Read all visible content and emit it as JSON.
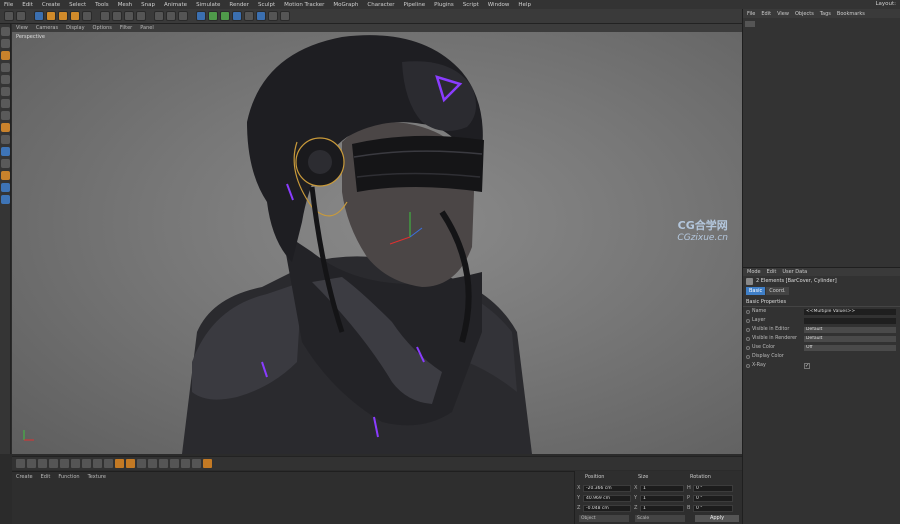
{
  "menubar": {
    "items": [
      "File",
      "Edit",
      "Create",
      "Select",
      "Tools",
      "Mesh",
      "Snap",
      "Animate",
      "Simulate",
      "Render",
      "Sculpt",
      "Motion Tracker",
      "MoGraph",
      "Character",
      "Pipeline",
      "Plugins",
      "Script",
      "Window",
      "Help"
    ],
    "layout_label": "Layout:"
  },
  "viewport": {
    "menu": [
      "View",
      "Cameras",
      "Display",
      "Options",
      "Filter",
      "Panel"
    ],
    "camera_label": "Perspective"
  },
  "watermark": {
    "line1": "CG合学网",
    "line2": "CGzixue.cn"
  },
  "bottom_manager": {
    "menu": [
      "Create",
      "Edit",
      "Function",
      "Texture"
    ]
  },
  "coordinates": {
    "headers": {
      "position": "Position",
      "size": "Size",
      "rotation": "Rotation"
    },
    "rows": [
      {
        "axis": "X",
        "position": "-20.366 cm",
        "size_axis": "X",
        "size": "1",
        "rot_axis": "H",
        "rotation": "0 °"
      },
      {
        "axis": "Y",
        "position": "40.969 cm",
        "size_axis": "Y",
        "size": "1",
        "rot_axis": "P",
        "rotation": "0 °"
      },
      {
        "axis": "Z",
        "position": "-0.048 cm",
        "size_axis": "Z",
        "size": "1",
        "rot_axis": "B",
        "rotation": "0 °"
      }
    ],
    "mode1": "Object",
    "mode2": "Scale",
    "apply": "Apply"
  },
  "object_manager": {
    "menu": [
      "File",
      "Edit",
      "View",
      "Objects",
      "Tags",
      "Bookmarks"
    ]
  },
  "attribute_manager": {
    "menu": [
      "Mode",
      "Edit",
      "User Data"
    ],
    "title": "2 Elements [BarCover, Cylinder]",
    "tabs": {
      "basic": "Basic",
      "coord": "Coord."
    },
    "section": "Basic Properties",
    "rows": [
      {
        "label": "Name",
        "value": "<<Multiple Values>>"
      },
      {
        "label": "Layer",
        "value": ""
      },
      {
        "label": "Visible in Editor",
        "value": "Default"
      },
      {
        "label": "Visible in Renderer",
        "value": "Default"
      },
      {
        "label": "Use Color",
        "value": "Off"
      },
      {
        "label": "Display Color",
        "value": ""
      },
      {
        "label": "X-Ray",
        "value": "✓"
      }
    ]
  },
  "colors": {
    "accent": "#3f7fc8",
    "neon": "#8a3cff"
  }
}
